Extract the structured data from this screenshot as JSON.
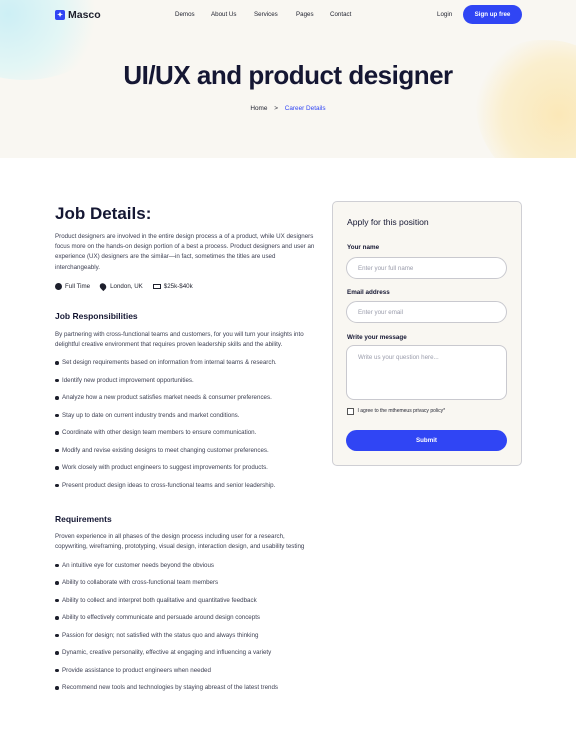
{
  "nav": {
    "logo": "Masco",
    "items": [
      "Demos",
      "About Us",
      "Services",
      "Pages",
      "Contact"
    ],
    "login": "Login",
    "signup": "Sign up free"
  },
  "hero": {
    "title": "UI/UX and product designer",
    "breadcrumb": {
      "home": "Home",
      "separator": ">",
      "current": "Career Details"
    }
  },
  "details": {
    "heading": "Job Details:",
    "intro": "Product designers are involved in the entire design process a of a product, while UX designers focus more on the hands-on design portion of a best a process. Product designers and user an experience (UX) designers are the similar—in fact, sometimes the titles are used interchangeably.",
    "meta": {
      "type": "Full Time",
      "location": "London, UK",
      "salary": "$25k-$40k"
    },
    "responsibilities": {
      "heading": "Job Responsibilities",
      "intro": "By partnering with cross-functional teams and customers, for you will turn your insights into delightful creative environment that requires proven leadership skills and the ability.",
      "items": [
        "Set design requirements based on information from internal teams & research.",
        "Identify new product improvement opportunities.",
        "Analyze how a new product satisfies market needs & consumer preferences.",
        "Stay up to date on current industry trends and market conditions.",
        "Coordinate with other design team members to ensure communication.",
        "Modify and revise existing designs to meet changing customer preferences.",
        "Work closely with product engineers to suggest improvements for products.",
        "Present product design ideas to cross-functional teams and senior leadership."
      ]
    },
    "requirements": {
      "heading": "Requirements",
      "intro": "Proven experience in all phases of the design process including user for a research, copywriting, wireframing, prototyping, visual design, interaction design, and usability testing",
      "items": [
        "An intuitive eye for customer needs beyond the obvious",
        "Ability to collaborate with cross-functional team members",
        "Ability to collect and interpret both qualitative and quantitative feedback",
        "Ability to effectively communicate and persuade around design concepts",
        "Passion for design; not satisfied with the status quo and always thinking",
        "Dynamic, creative personality, effective at engaging and influencing a variety",
        "Provide assistance to product engineers when needed",
        "Recommend new tools and technologies by staying abreast of the latest trends"
      ]
    }
  },
  "form": {
    "title": "Apply for this position",
    "name_label": "Your name",
    "name_placeholder": "Enter your full name",
    "email_label": "Email address",
    "email_placeholder": "Enter your email",
    "message_label": "Write your message",
    "message_placeholder": "Write us your question here...",
    "agree": "I agree to the mthemeus privacy policy*",
    "submit": "Submit"
  },
  "colors": {
    "accent": "#3045f4",
    "hero_bg": "#f9f7f2",
    "heading": "#151733"
  }
}
